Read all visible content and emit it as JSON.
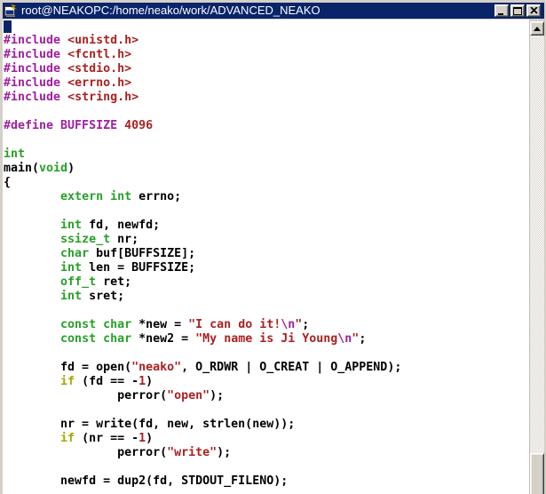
{
  "window": {
    "title": "root@NEAKOPC:/home/neako/work/ADVANCED_NEAKO",
    "controls": [
      {
        "name": "minimize",
        "label": "minimize"
      },
      {
        "name": "maximize",
        "label": "maximize"
      },
      {
        "name": "close",
        "label": "close"
      }
    ]
  },
  "icons": {
    "titlebar": "terminal-with-lightning",
    "scrollbar_up": "triangle-up"
  },
  "colors": {
    "ui": {
      "titlebar_bg": "#0A246A",
      "titlebar_text": "#FFFFFF",
      "chrome": "#D4D0C8",
      "content_bg": "#FFFFFF",
      "cursor": "#0A246A"
    },
    "tokens": {
      "plain": "#000000",
      "preproc": "#A020A0",
      "const": "#AA2222",
      "type": "#28A028",
      "stmt": "#A8A800",
      "spec": "#A020A0"
    }
  },
  "code": {
    "lines": [
      {
        "cursor": true,
        "segments": []
      },
      {
        "segments": [
          {
            "c": "preproc",
            "t": "#include"
          },
          {
            "c": "plain",
            "t": " "
          },
          {
            "c": "const",
            "t": "<unistd.h>"
          }
        ]
      },
      {
        "segments": [
          {
            "c": "preproc",
            "t": "#include"
          },
          {
            "c": "plain",
            "t": " "
          },
          {
            "c": "const",
            "t": "<fcntl.h>"
          }
        ]
      },
      {
        "segments": [
          {
            "c": "preproc",
            "t": "#include"
          },
          {
            "c": "plain",
            "t": " "
          },
          {
            "c": "const",
            "t": "<stdio.h>"
          }
        ]
      },
      {
        "segments": [
          {
            "c": "preproc",
            "t": "#include"
          },
          {
            "c": "plain",
            "t": " "
          },
          {
            "c": "const",
            "t": "<errno.h>"
          }
        ]
      },
      {
        "segments": [
          {
            "c": "preproc",
            "t": "#include"
          },
          {
            "c": "plain",
            "t": " "
          },
          {
            "c": "const",
            "t": "<string.h>"
          }
        ]
      },
      {
        "segments": []
      },
      {
        "segments": [
          {
            "c": "preproc",
            "t": "#define BUFFSIZE"
          },
          {
            "c": "plain",
            "t": " "
          },
          {
            "c": "const",
            "t": "4096"
          }
        ]
      },
      {
        "segments": []
      },
      {
        "segments": [
          {
            "c": "type",
            "t": "int"
          }
        ]
      },
      {
        "segments": [
          {
            "c": "plain",
            "t": "main("
          },
          {
            "c": "type",
            "t": "void"
          },
          {
            "c": "plain",
            "t": ")"
          }
        ]
      },
      {
        "segments": [
          {
            "c": "plain",
            "t": "{"
          }
        ]
      },
      {
        "segments": [
          {
            "c": "plain",
            "t": "        "
          },
          {
            "c": "type",
            "t": "extern int"
          },
          {
            "c": "plain",
            "t": " errno;"
          }
        ]
      },
      {
        "segments": []
      },
      {
        "segments": [
          {
            "c": "plain",
            "t": "        "
          },
          {
            "c": "type",
            "t": "int"
          },
          {
            "c": "plain",
            "t": " fd, newfd;"
          }
        ]
      },
      {
        "segments": [
          {
            "c": "plain",
            "t": "        "
          },
          {
            "c": "type",
            "t": "ssize_t"
          },
          {
            "c": "plain",
            "t": " nr;"
          }
        ]
      },
      {
        "segments": [
          {
            "c": "plain",
            "t": "        "
          },
          {
            "c": "type",
            "t": "char"
          },
          {
            "c": "plain",
            "t": " buf[BUFFSIZE];"
          }
        ]
      },
      {
        "segments": [
          {
            "c": "plain",
            "t": "        "
          },
          {
            "c": "type",
            "t": "int"
          },
          {
            "c": "plain",
            "t": " len = BUFFSIZE;"
          }
        ]
      },
      {
        "segments": [
          {
            "c": "plain",
            "t": "        "
          },
          {
            "c": "type",
            "t": "off_t"
          },
          {
            "c": "plain",
            "t": " ret;"
          }
        ]
      },
      {
        "segments": [
          {
            "c": "plain",
            "t": "        "
          },
          {
            "c": "type",
            "t": "int"
          },
          {
            "c": "plain",
            "t": " sret;"
          }
        ]
      },
      {
        "segments": []
      },
      {
        "segments": [
          {
            "c": "plain",
            "t": "        "
          },
          {
            "c": "type",
            "t": "const char"
          },
          {
            "c": "plain",
            "t": " *new = "
          },
          {
            "c": "const",
            "t": "\"I can do it!"
          },
          {
            "c": "spec",
            "t": "\\n"
          },
          {
            "c": "const",
            "t": "\""
          },
          {
            "c": "plain",
            "t": ";"
          }
        ]
      },
      {
        "segments": [
          {
            "c": "plain",
            "t": "        "
          },
          {
            "c": "type",
            "t": "const char"
          },
          {
            "c": "plain",
            "t": " *new2 = "
          },
          {
            "c": "const",
            "t": "\"My name is Ji Young"
          },
          {
            "c": "spec",
            "t": "\\n"
          },
          {
            "c": "const",
            "t": "\""
          },
          {
            "c": "plain",
            "t": ";"
          }
        ]
      },
      {
        "segments": []
      },
      {
        "segments": [
          {
            "c": "plain",
            "t": "        fd = open("
          },
          {
            "c": "const",
            "t": "\"neako\""
          },
          {
            "c": "plain",
            "t": ", O_RDWR | O_CREAT | O_APPEND);"
          }
        ]
      },
      {
        "segments": [
          {
            "c": "plain",
            "t": "        "
          },
          {
            "c": "stmt",
            "t": "if"
          },
          {
            "c": "plain",
            "t": " (fd == -"
          },
          {
            "c": "const",
            "t": "1"
          },
          {
            "c": "plain",
            "t": ")"
          }
        ]
      },
      {
        "segments": [
          {
            "c": "plain",
            "t": "                perror("
          },
          {
            "c": "const",
            "t": "\"open\""
          },
          {
            "c": "plain",
            "t": ");"
          }
        ]
      },
      {
        "segments": []
      },
      {
        "segments": [
          {
            "c": "plain",
            "t": "        nr = write(fd, new, strlen(new));"
          }
        ]
      },
      {
        "segments": [
          {
            "c": "plain",
            "t": "        "
          },
          {
            "c": "stmt",
            "t": "if"
          },
          {
            "c": "plain",
            "t": " (nr == -"
          },
          {
            "c": "const",
            "t": "1"
          },
          {
            "c": "plain",
            "t": ")"
          }
        ]
      },
      {
        "segments": [
          {
            "c": "plain",
            "t": "                perror("
          },
          {
            "c": "const",
            "t": "\"write\""
          },
          {
            "c": "plain",
            "t": ");"
          }
        ]
      },
      {
        "segments": []
      },
      {
        "segments": [
          {
            "c": "plain",
            "t": "        newfd = dup2(fd, STDOUT_FILENO);"
          }
        ]
      }
    ]
  }
}
